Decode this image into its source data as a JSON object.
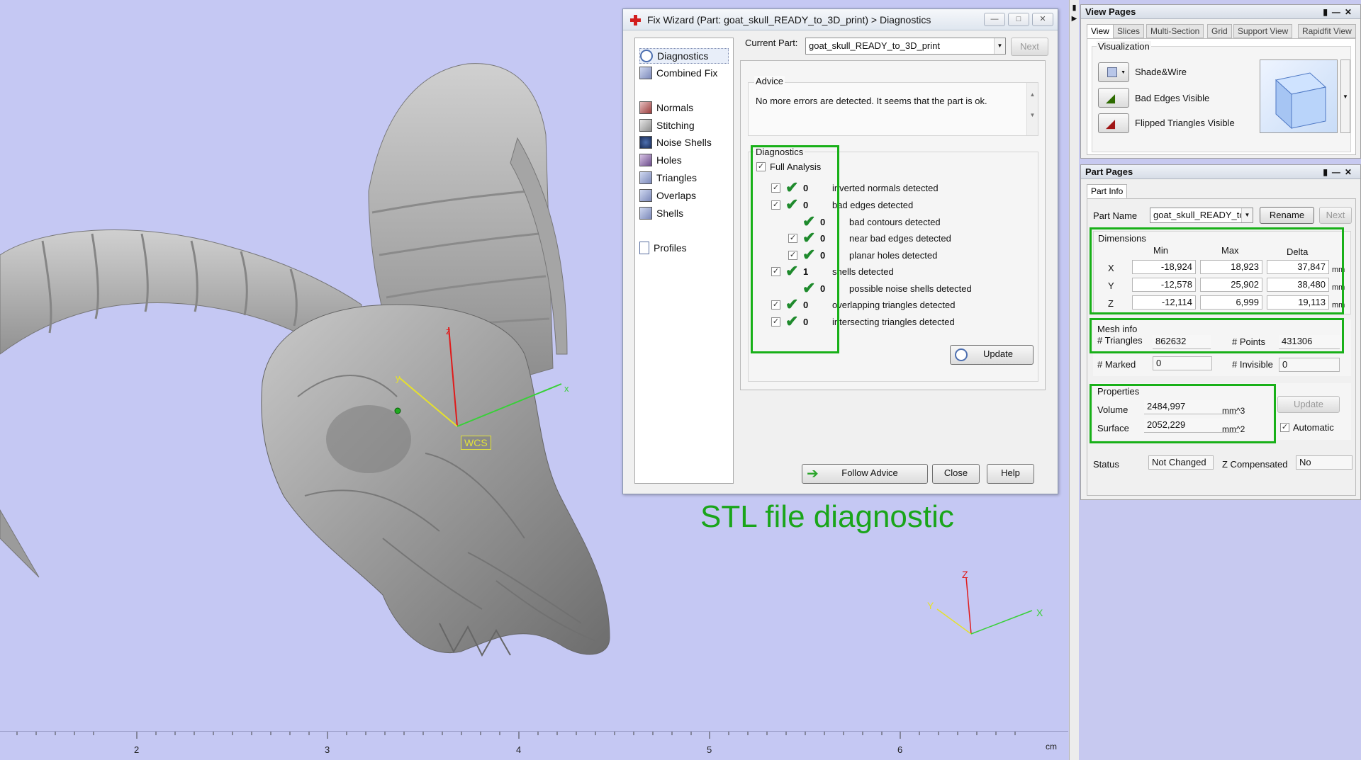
{
  "viewport": {
    "wcs_label": "WCS",
    "caption": "STL file diagnostic",
    "ruler": {
      "ticks": [
        "2",
        "3",
        "4",
        "5",
        "6"
      ],
      "unit": "cm"
    },
    "axes": {
      "x": "x",
      "y": "y",
      "z": "z",
      "gx": "X",
      "gy": "Y",
      "gz": "Z"
    }
  },
  "wizard": {
    "title": "Fix Wizard (Part: goat_skull_READY_to_3D_print) > Diagnostics",
    "nav": [
      "Diagnostics",
      "Combined Fix",
      "Normals",
      "Stitching",
      "Noise Shells",
      "Holes",
      "Triangles",
      "Overlaps",
      "Shells",
      "Profiles"
    ],
    "current_part_label": "Current Part:",
    "current_part": "goat_skull_READY_to_3D_print",
    "next_label": "Next",
    "advice_title": "Advice",
    "advice_text": "No more errors are detected. It seems that the part is ok.",
    "diagnostics_title": "Diagnostics",
    "full_analysis": "Full Analysis",
    "rows": [
      {
        "value": "0",
        "text": "inverted normals detected"
      },
      {
        "value": "0",
        "text": "bad edges detected"
      },
      {
        "value": "0",
        "text": "bad contours detected"
      },
      {
        "value": "0",
        "text": "near bad edges detected"
      },
      {
        "value": "0",
        "text": "planar holes detected"
      },
      {
        "value": "1",
        "text": "shells detected"
      },
      {
        "value": "0",
        "text": "possible noise shells detected"
      },
      {
        "value": "0",
        "text": "overlapping triangles detected"
      },
      {
        "value": "0",
        "text": "intersecting triangles detected"
      }
    ],
    "update_label": "Update",
    "follow_label": "Follow Advice",
    "close_label": "Close",
    "help_label": "Help"
  },
  "view_pages": {
    "title": "View Pages",
    "tabs": [
      "View",
      "Slices",
      "Multi-Section",
      "Grid",
      "Support View",
      "Rapidfit View"
    ],
    "visualization": "Visualization",
    "items": [
      "Shade&Wire",
      "Bad Edges Visible",
      "Flipped Triangles Visible"
    ]
  },
  "part_pages": {
    "title": "Part Pages",
    "tab": "Part Info",
    "part_name_label": "Part Name",
    "part_name": "goat_skull_READY_tc",
    "rename": "Rename",
    "next": "Next",
    "dimensions": {
      "title": "Dimensions",
      "headers": [
        "Min",
        "Max",
        "Delta"
      ],
      "rows": [
        {
          "axis": "X",
          "min": "-18,924",
          "max": "18,923",
          "delta": "37,847",
          "unit": "mm"
        },
        {
          "axis": "Y",
          "min": "-12,578",
          "max": "25,902",
          "delta": "38,480",
          "unit": "mm"
        },
        {
          "axis": "Z",
          "min": "-12,114",
          "max": "6,999",
          "delta": "19,113",
          "unit": "mm"
        }
      ]
    },
    "mesh": {
      "title": "Mesh info",
      "triangles_label": "# Triangles",
      "triangles": "862632",
      "points_label": "# Points",
      "points": "431306",
      "marked_label": "# Marked",
      "marked": "0",
      "invisible_label": "# Invisible",
      "invisible": "0"
    },
    "properties": {
      "title": "Properties",
      "volume_label": "Volume",
      "volume": "2484,997",
      "volume_unit": "mm^3",
      "surface_label": "Surface",
      "surface": "2052,229",
      "surface_unit": "mm^2",
      "update": "Update",
      "automatic": "Automatic"
    },
    "status_label": "Status",
    "status": "Not Changed",
    "zcomp_label": "Z Compensated",
    "zcomp": "No"
  },
  "colors": {
    "accent_green": "#18b018",
    "viewport": "#c5c8f3",
    "check": "#1e8a2c"
  }
}
